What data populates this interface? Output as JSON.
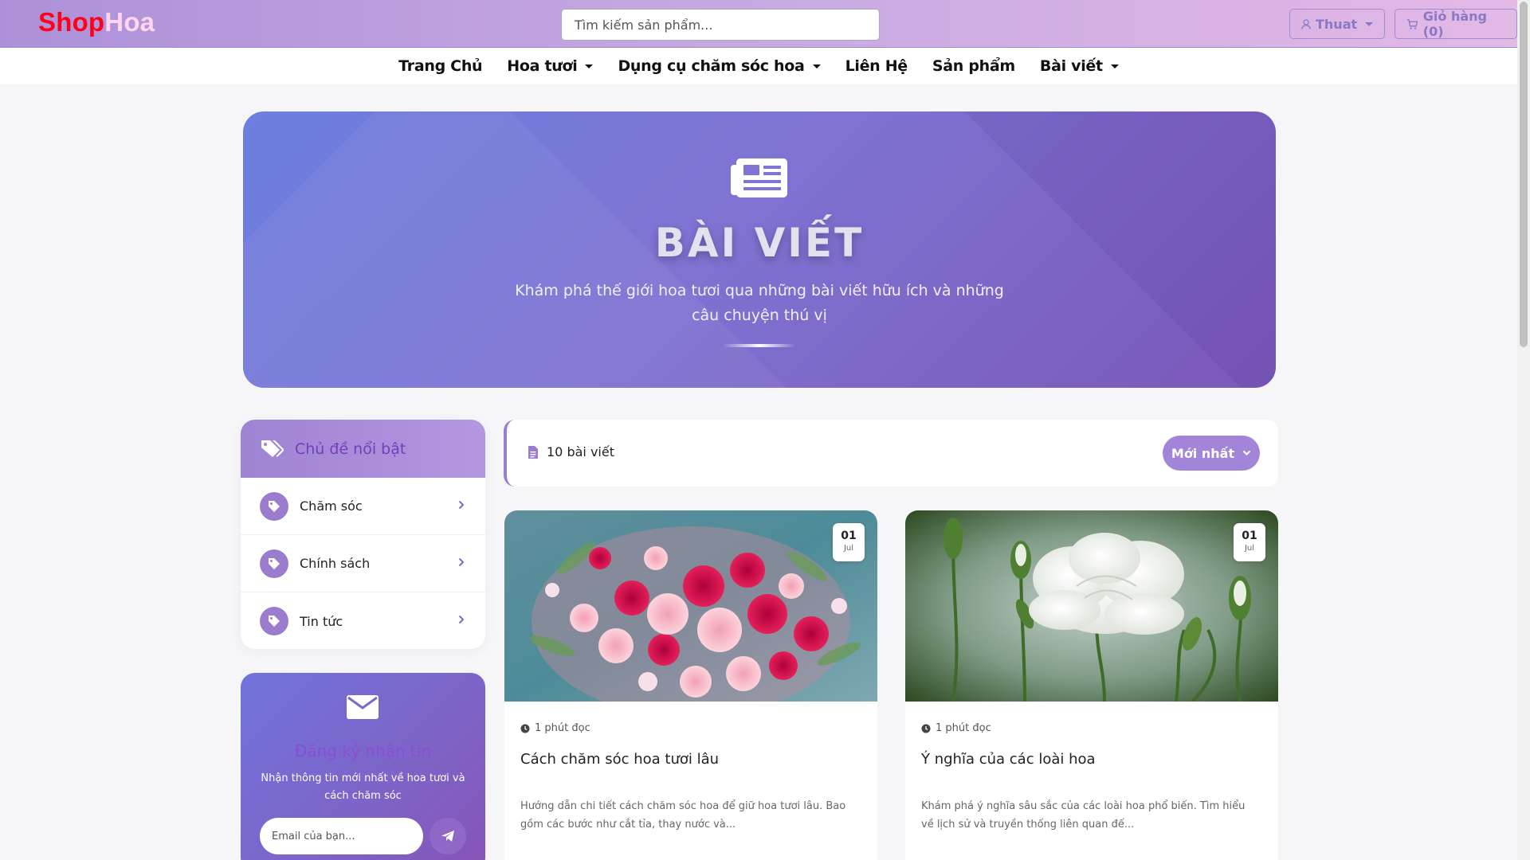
{
  "header": {
    "logo_part1": "Shop",
    "logo_part2": "Hoa",
    "search_placeholder": "Tìm kiếm sản phẩm...",
    "user_label": "Thuat",
    "cart_label": "Giỏ hàng (0)"
  },
  "nav": {
    "items": [
      {
        "label": "Trang Chủ",
        "dropdown": false
      },
      {
        "label": "Hoa tươi",
        "dropdown": true
      },
      {
        "label": "Dụng cụ chăm sóc hoa",
        "dropdown": true
      },
      {
        "label": "Liên Hệ",
        "dropdown": false
      },
      {
        "label": "Sản phẩm",
        "dropdown": false
      },
      {
        "label": "Bài viết",
        "dropdown": true
      }
    ]
  },
  "hero": {
    "icon": "newspaper-icon",
    "title": "BÀI VIẾT",
    "subtitle": "Khám phá thế giới hoa tươi qua những bài viết hữu ích và những câu chuyện thú vị"
  },
  "sidebar": {
    "topics_title": "Chủ đề nổi bật",
    "topics": [
      {
        "label": "Chăm sóc"
      },
      {
        "label": "Chính sách"
      },
      {
        "label": "Tin tức"
      }
    ],
    "newsletter": {
      "title": "Đăng ký nhận tin",
      "description": "Nhận thông tin mới nhất về hoa tươi và cách chăm sóc",
      "email_placeholder": "Email của bạn..."
    }
  },
  "toolbar": {
    "count_label": "10 bài viết",
    "sort_label": "Mới nhất"
  },
  "articles": [
    {
      "day": "01",
      "month": "Jul",
      "read_time": "1 phút đọc",
      "title": "Cách chăm sóc hoa tươi lâu",
      "excerpt": "Hướng dẫn chi tiết cách chăm sóc hoa để giữ hoa tươi lâu. Bao gồm các bước như cắt tỉa, thay nước và..."
    },
    {
      "day": "01",
      "month": "Jul",
      "read_time": "1 phút đọc",
      "title": "Ý nghĩa của các loài hoa",
      "excerpt": "Khám phá ý nghĩa sâu sắc của các loài hoa phổ biến. Tìm hiểu về lịch sử và truyền thống liên quan đế..."
    }
  ],
  "colors": {
    "brand_red": "#ff0018",
    "accent_purple": "#9b7dd0",
    "hero_start": "#6c7fe0",
    "hero_end": "#7a58b8"
  }
}
